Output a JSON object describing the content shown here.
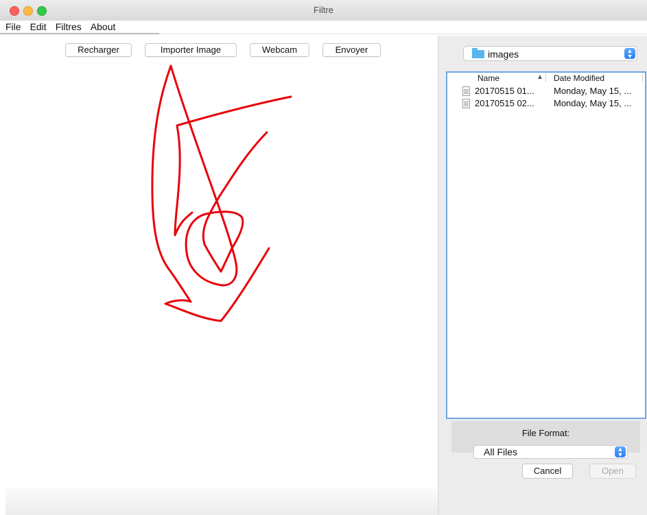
{
  "window": {
    "title": "Filtre"
  },
  "menu": [
    "File",
    "Edit",
    "Filtres",
    "About"
  ],
  "toolbar": {
    "reload_label": "Recharger",
    "import_label": "Importer Image",
    "webcam_label": "Webcam",
    "send_label": "Envoyer"
  },
  "drawing": {
    "stroke_color": "#e8000b"
  },
  "chooser": {
    "folder": "images",
    "columns": {
      "name": "Name",
      "date": "Date Modified"
    },
    "files": [
      {
        "name": "20170515 01...",
        "date": "Monday, May 15, ..."
      },
      {
        "name": "20170515 02...",
        "date": "Monday, May 15, ..."
      }
    ],
    "format_label": "File Format:",
    "format_value": "All Files",
    "cancel_label": "Cancel",
    "open_label": "Open"
  }
}
